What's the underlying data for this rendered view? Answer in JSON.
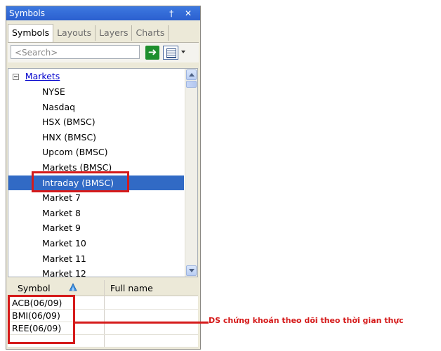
{
  "window": {
    "title": "Symbols",
    "controls": "† ✕"
  },
  "tabs": [
    {
      "label": "Symbols",
      "active": true
    },
    {
      "label": "Layouts",
      "active": false
    },
    {
      "label": "Layers",
      "active": false
    },
    {
      "label": "Charts",
      "active": false
    }
  ],
  "search": {
    "placeholder": "<Search>",
    "go_icon": "arrow-right-icon",
    "view_icon": "list-view-icon"
  },
  "tree": {
    "root": "Markets",
    "items": [
      {
        "label": "NYSE"
      },
      {
        "label": "Nasdaq"
      },
      {
        "label": "HSX (BMSC)"
      },
      {
        "label": "HNX (BMSC)"
      },
      {
        "label": "Upcom (BMSC)"
      },
      {
        "label": "Markets (BMSC)"
      },
      {
        "label": "Intraday (BMSC)",
        "selected": true
      },
      {
        "label": "Market 7"
      },
      {
        "label": "Market 8"
      },
      {
        "label": "Market 9"
      },
      {
        "label": "Market 10"
      },
      {
        "label": "Market 11"
      },
      {
        "label": "Market 12"
      }
    ]
  },
  "grid": {
    "columns": [
      "Symbol",
      "Full name"
    ],
    "rows": [
      {
        "symbol": "ACB(06/09)",
        "full_name": ""
      },
      {
        "symbol": "BMI(06/09)",
        "full_name": ""
      },
      {
        "symbol": "REE(06/09)",
        "full_name": ""
      }
    ]
  },
  "annotation": {
    "text": "DS chứng khoán theo dõi theo thời gian thực",
    "color": "#d51a1a"
  },
  "colors": {
    "selection": "#316ac5",
    "titlebar": "#2b5fcf",
    "highlight": "#d51a1a"
  }
}
